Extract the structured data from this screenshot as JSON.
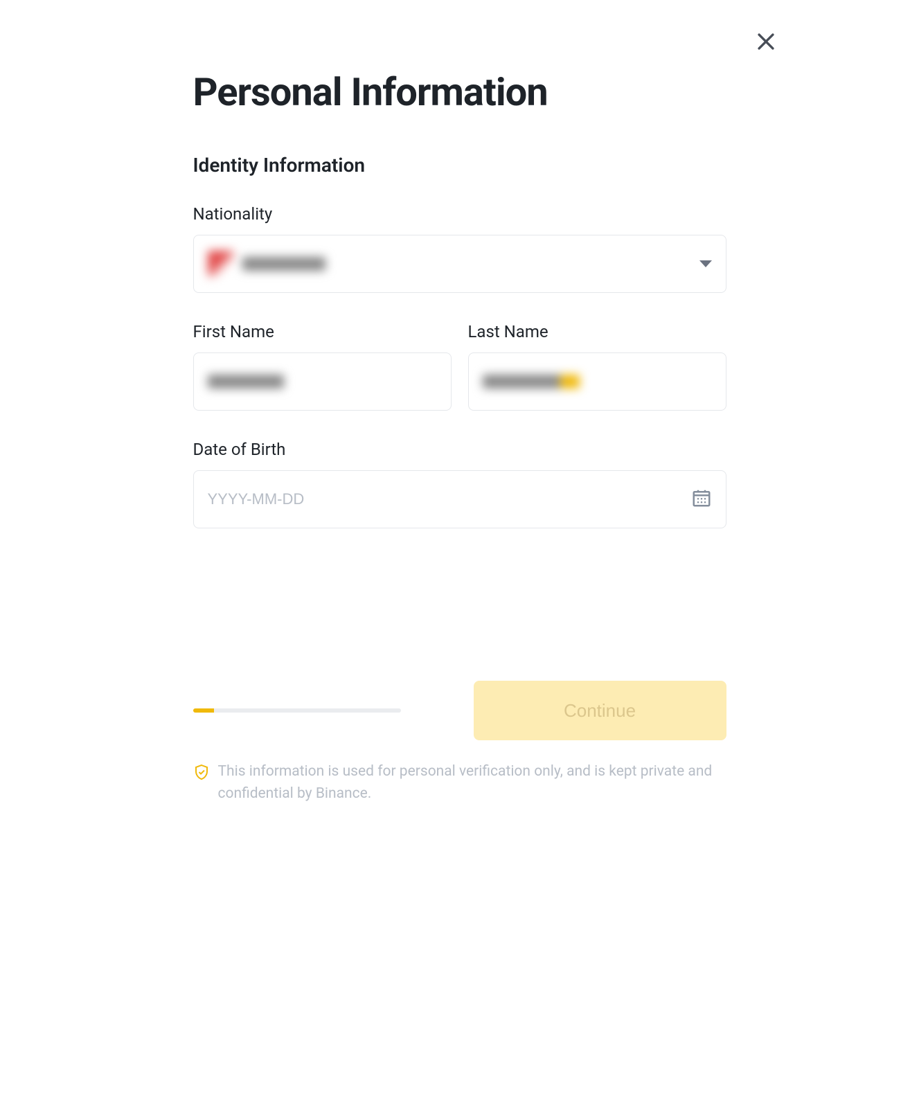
{
  "modal": {
    "title": "Personal Information",
    "section_title": "Identity Information",
    "fields": {
      "nationality": {
        "label": "Nationality",
        "value": ""
      },
      "first_name": {
        "label": "First Name",
        "value": ""
      },
      "last_name": {
        "label": "Last Name",
        "value": ""
      },
      "dob": {
        "label": "Date of Birth",
        "placeholder": "YYYY-MM-DD",
        "value": ""
      }
    },
    "continue_label": "Continue",
    "progress_percent": 10,
    "disclaimer": "This information is used for personal verification only, and is kept private and confidential by Binance."
  },
  "colors": {
    "accent": "#f0b90b",
    "text_primary": "#1e2329",
    "text_muted": "#b7bdc6",
    "border": "#e5e7eb"
  }
}
